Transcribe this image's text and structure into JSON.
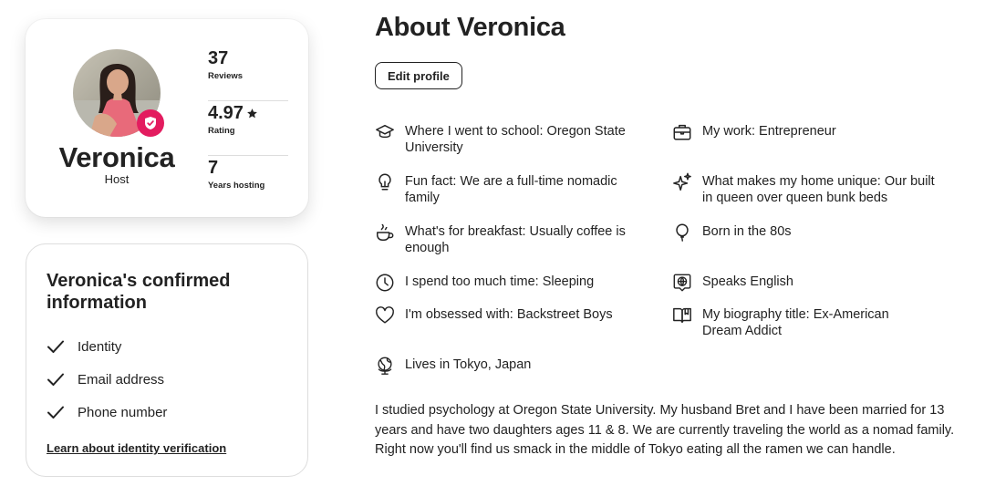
{
  "profile": {
    "name": "Veronica",
    "role": "Host",
    "avatar_alt": "Veronica",
    "stats": [
      {
        "value": "37",
        "label": "Reviews"
      },
      {
        "value": "4.97",
        "label": "Rating",
        "icon": "star-icon"
      },
      {
        "value": "7",
        "label": "Years hosting"
      }
    ]
  },
  "confirmed": {
    "title": "Veronica's confirmed information",
    "items": [
      "Identity",
      "Email address",
      "Phone number"
    ],
    "link": "Learn about identity verification"
  },
  "about": {
    "title": "About Veronica",
    "edit_button": "Edit profile",
    "facts": [
      {
        "icon": "graduation-cap-icon",
        "text": "Where I went to school: Oregon State University"
      },
      {
        "icon": "briefcase-icon",
        "text": "My work: Entrepreneur"
      },
      {
        "icon": "lightbulb-icon",
        "text": "Fun fact: We are a full-time nomadic family"
      },
      {
        "icon": "sparkles-icon",
        "text": "What makes my home unique: Our built in queen over queen bunk beds"
      },
      {
        "icon": "coffee-icon",
        "text": "What's for breakfast: Usually coffee is enough"
      },
      {
        "icon": "balloon-icon",
        "text": "Born in the 80s"
      },
      {
        "icon": "clock-icon",
        "text": "I spend too much time: Sleeping"
      },
      {
        "icon": "speech-globe-icon",
        "text": "Speaks English"
      },
      {
        "icon": "heart-icon",
        "text": "I'm obsessed with: Backstreet Boys"
      },
      {
        "icon": "book-icon",
        "text": "My biography title: Ex-American Dream Addict"
      },
      {
        "icon": "globe-pin-icon",
        "text": "Lives in Tokyo, Japan"
      }
    ],
    "bio": "I studied psychology at Oregon State University. My husband Bret and I have been married for 13 years and have two daughters ages 11 & 8. We are currently traveling the world as a nomad family. Right now you'll find us smack in the middle of Tokyo eating all the ramen we can handle."
  },
  "colors": {
    "accent": "#e31c5f",
    "text": "#222222",
    "border": "#dddddd"
  }
}
